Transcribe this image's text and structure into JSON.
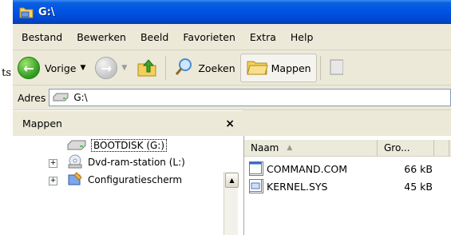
{
  "window": {
    "title": "G:\\"
  },
  "menubar": [
    {
      "label": "Bestand"
    },
    {
      "label": "Bewerken"
    },
    {
      "label": "Beeld"
    },
    {
      "label": "Favorieten"
    },
    {
      "label": "Extra"
    },
    {
      "label": "Help"
    }
  ],
  "toolbar": {
    "back_label": "Vorige",
    "search_label": "Zoeken",
    "folders_label": "Mappen"
  },
  "address": {
    "label": "Adres",
    "value": "G:\\"
  },
  "folders_panel": {
    "title": "Mappen",
    "close": "×",
    "items": [
      {
        "label": "BOOTDISK (G:)",
        "icon": "drive-icon",
        "expander": ""
      },
      {
        "label": "Dvd-ram-station (L:)",
        "icon": "dvd-drive-icon",
        "expander": "+"
      },
      {
        "label": "Configuratiescherm",
        "icon": "control-panel-icon",
        "expander": "+"
      }
    ]
  },
  "file_list": {
    "columns": [
      "Naam",
      "Gro..."
    ],
    "sort_indicator": "▲",
    "rows": [
      {
        "name": "COMMAND.COM",
        "size": "66 kB",
        "icon": "application-file-icon"
      },
      {
        "name": "KERNEL.SYS",
        "size": "45 kB",
        "icon": "system-file-icon"
      }
    ]
  },
  "stray_text": "ts",
  "colors": {
    "titlebar": "#0054e3",
    "chrome": "#ece9d8",
    "back_button": "#2d9a1f"
  }
}
